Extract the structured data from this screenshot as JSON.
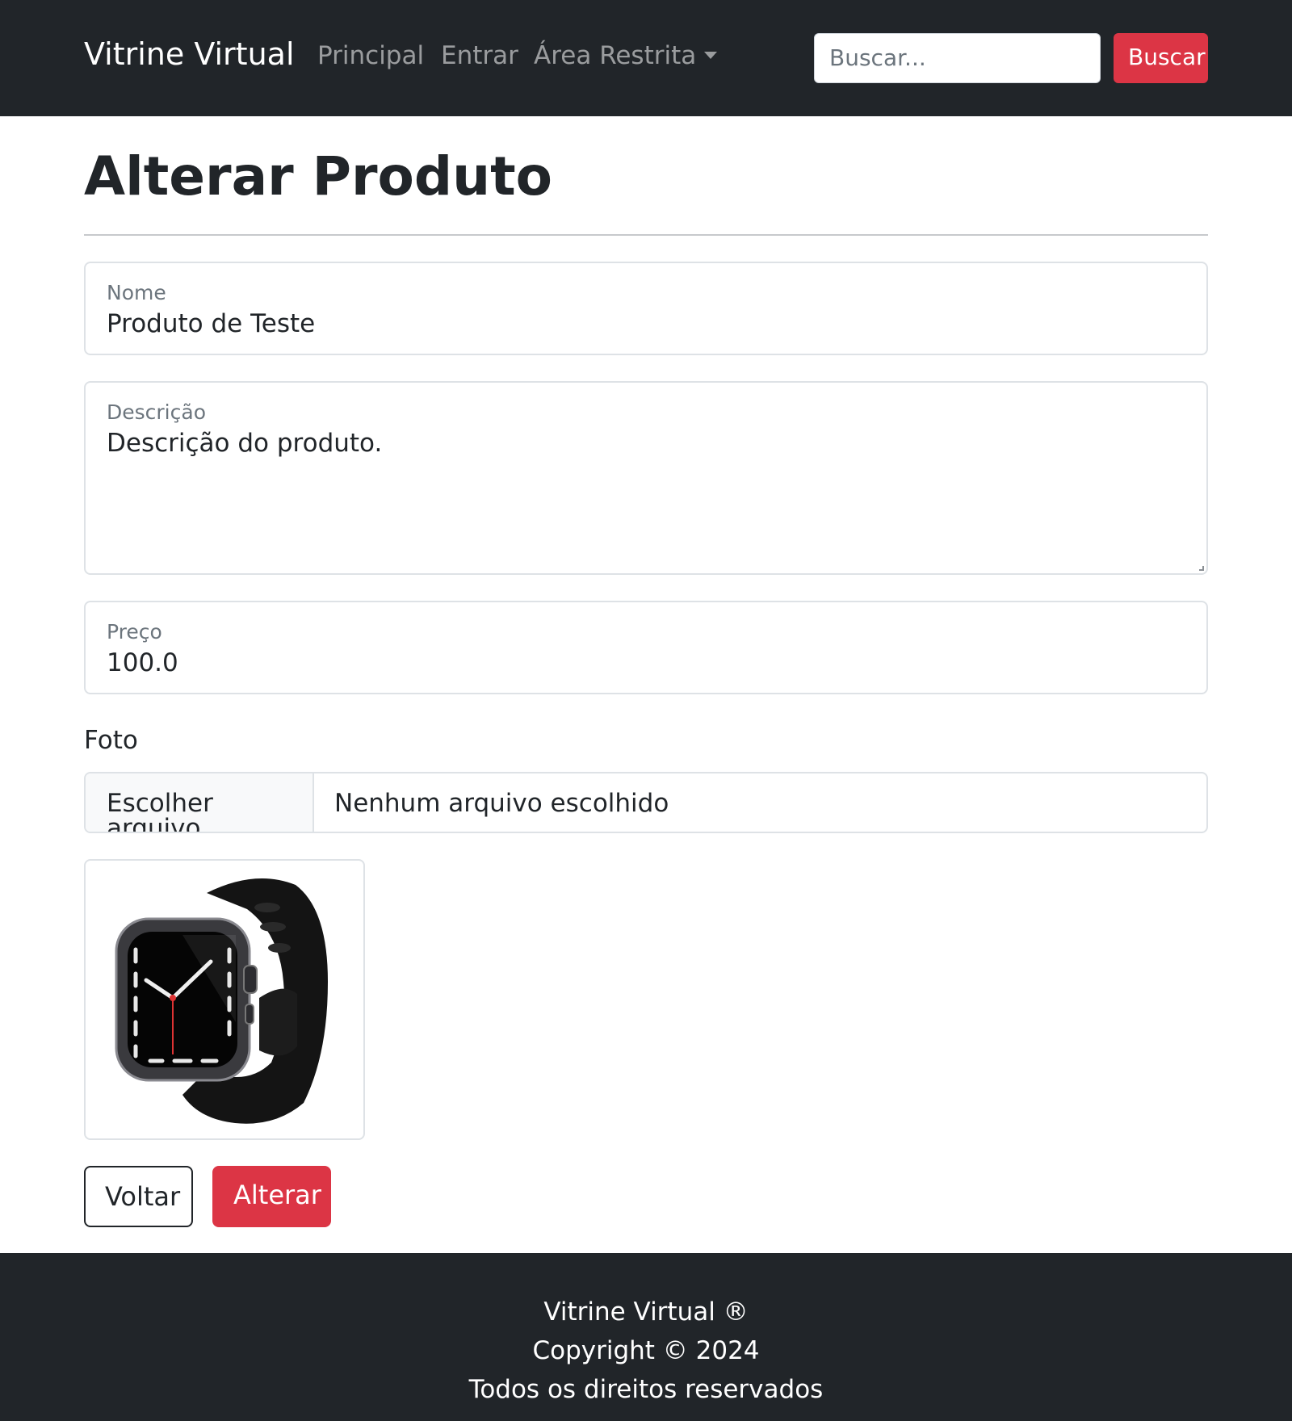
{
  "navbar": {
    "brand": "Vitrine Virtual",
    "links": [
      "Principal",
      "Entrar",
      "Área Restrita"
    ],
    "search_placeholder": "Buscar...",
    "search_button": "Buscar"
  },
  "page": {
    "title": "Alterar Produto"
  },
  "form": {
    "nome_label": "Nome",
    "nome_value": "Produto de Teste",
    "descricao_label": "Descrição",
    "descricao_value": "Descrição do produto.",
    "preco_label": "Preço",
    "preco_value": "100.0",
    "foto_label": "Foto",
    "file_button": "Escolher arquivo",
    "file_status": "Nenhum arquivo escolhido",
    "photo_icon": "smartwatch-photo"
  },
  "actions": {
    "voltar": "Voltar",
    "alterar": "Alterar"
  },
  "footer": {
    "line1": "Vitrine Virtual ®",
    "line2": "Copyright © 2024",
    "line3": "Todos os direitos reservados"
  },
  "colors": {
    "navbar_bg": "#212529",
    "accent": "#dc3545",
    "border": "#dee2e6"
  }
}
